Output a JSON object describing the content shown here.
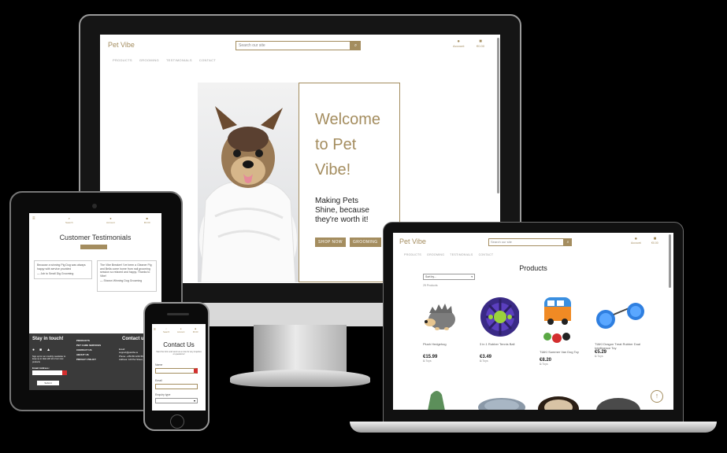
{
  "site": {
    "brand": "Pet Vibe",
    "search_placeholder": "Search our site",
    "account_label": "Account",
    "cart_amount": "€0.00",
    "nav": [
      "PRODUCTS",
      "GROOMING",
      "TESTIMONIALS",
      "CONTACT"
    ]
  },
  "desktop": {
    "hero_title": "Welcome to Pet Vibe!",
    "hero_subtitle": "Making Pets Shine, because they're worth it!",
    "shop_now_label": "SHOP NOW",
    "grooming_label": "GROOMING"
  },
  "laptop": {
    "page_title": "Products",
    "sort_value": "Sort by...",
    "product_count": "25 Products",
    "products": [
      {
        "name": "Plush Hedgehog",
        "price": "€15.99",
        "tag": "Toys"
      },
      {
        "name": "3 in 1 Rubber Tennis Ball",
        "price": "€3.49",
        "tag": "Toys"
      },
      {
        "name": "TIAKI Summer Van Dog Toy",
        "price": "€8.20",
        "tag": "Toys"
      },
      {
        "name": "TIAKI Dragon Treat Rubber Dual Intelligence Toy",
        "price": "€5.29",
        "tag": "Toys"
      }
    ]
  },
  "tablet": {
    "page_title": "Customer Testimonials",
    "review_label": "",
    "testimonials": [
      {
        "text": "Because a winning Pig Dog was always happy with service provided",
        "author": "— Job to Small Dig Grooming"
      },
      {
        "text": "The Vibe Breaker! I've been a Gleaner Pig and Bella come home from nail grooming session so relaxed and happy. Thanks to Vibe!",
        "author": "— Sharon Winning Dog Grooming"
      }
    ],
    "footer": {
      "stay_title": "Stay in touch!",
      "newsletter_text": "Sign up for our monthly newsletter to keep up to date with all of our new products",
      "email_label": "Email Address:",
      "submit_label": "Submit",
      "links": [
        "PRODUCTS",
        "PET CARE SERVICES",
        "CONTACT US",
        "ABOUT US",
        "PRIVACY POLICY"
      ],
      "contact_title": "Contact us",
      "contact_lines": [
        "Email:",
        "support@petvibe.ie",
        "Phone: +353 89 1234 567",
        "Address: 123 Pet Street, City, PE 12345"
      ]
    }
  },
  "phone": {
    "page_title": "Contact Us",
    "intro": "Start the form and send us a note for any inquiries or questions!",
    "name_label": "Name",
    "email_label": "Email",
    "enquiry_label": "Enquiry type"
  },
  "colors": {
    "brand": "#a48d5f",
    "background": "#000000"
  }
}
